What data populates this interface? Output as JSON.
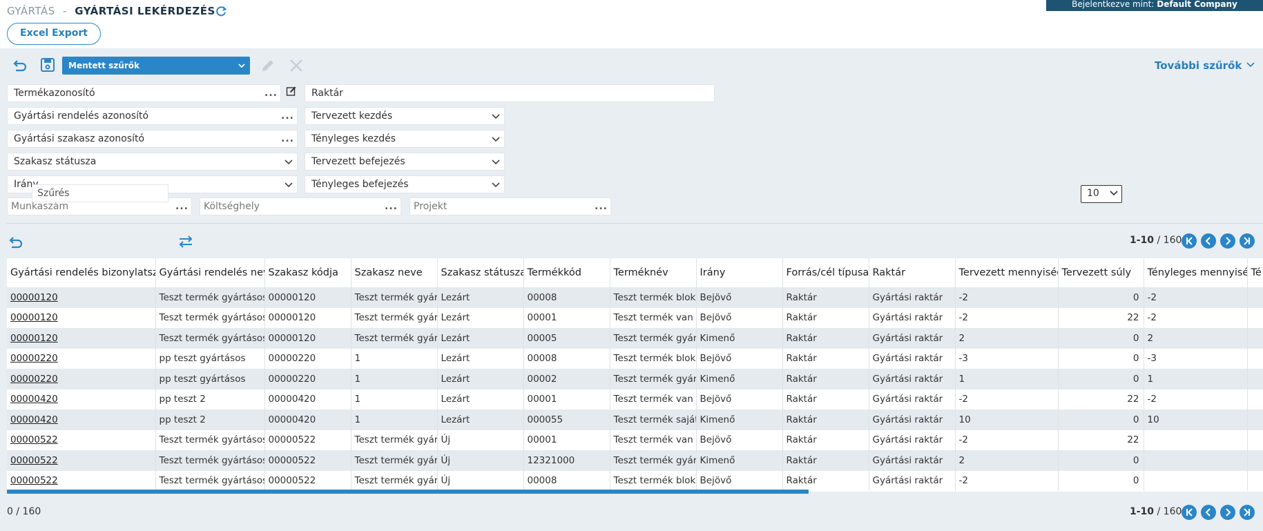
{
  "header": {
    "section": "GYÁRTÁS",
    "separator": "-",
    "title": "GYÁRTÁSI LEKÉRDEZÉS",
    "login_prefix": "Bejelentkezve mint:",
    "login_company": "Default Company",
    "excel_export": "Excel Export"
  },
  "filters": {
    "saved_filters": "Mentett szűrők",
    "more_filters": "További szűrők",
    "termekazonosito": "Termékazonosító",
    "raktar": "Raktár",
    "gyartasi_rendeles_azonosito": "Gyártási rendelés azonosító",
    "tervezett_kezdes": "Tervezett kezdés",
    "gyartasi_szakasz_azonosito": "Gyártási szakasz azonosító",
    "tenyleges_kezdes": "Tényleges kezdés",
    "szakasz_statusza": "Szakasz státusza",
    "tervezett_befejezes": "Tervezett befejezés",
    "irany": "Irány",
    "tenyleges_befejezes": "Tényleges befejezés",
    "munkaszam": "Munkaszám",
    "koltseghely": "Költséghely",
    "projekt": "Projekt",
    "dots": "..."
  },
  "grid_toolbar": {
    "search_value": "Szűrés",
    "page_size": "10",
    "range": "1-10",
    "total_sep": " / ",
    "total": "160"
  },
  "table": {
    "columns": [
      "Gyártási rendelés bizonylatszáma",
      "Gyártási rendelés neve",
      "Szakasz kódja",
      "Szakasz neve",
      "Szakasz státusza",
      "Termékkód",
      "Terméknév",
      "Irány",
      "Forrás/cél típusa",
      "Raktár",
      "Tervezett mennyiség",
      "Tervezett súly",
      "Tényleges mennyiség",
      "Té"
    ],
    "rows": [
      [
        "00000120",
        "Teszt termék gyártásos (",
        "00000120",
        "Teszt termék gyárt",
        "Lezárt",
        "00008",
        "Teszt termék blokk",
        "Bejövő",
        "Raktár",
        "Gyártási raktár",
        "-2",
        "0",
        "-2",
        ""
      ],
      [
        "00000120",
        "Teszt termék gyártásos (",
        "00000120",
        "Teszt termék gyárt",
        "Lezárt",
        "00001",
        "Teszt termék van k",
        "Bejövő",
        "Raktár",
        "Gyártási raktár",
        "-2",
        "22",
        "-2",
        ""
      ],
      [
        "00000120",
        "Teszt termék gyártásos (",
        "00000120",
        "Teszt termék gyárt",
        "Lezárt",
        "00005",
        "Teszt termék gyárt",
        "Kimenő",
        "Raktár",
        "Gyártási raktár",
        "2",
        "0",
        "2",
        ""
      ],
      [
        "00000220",
        "pp teszt gyártásos",
        "00000220",
        "1",
        "Lezárt",
        "00008",
        "Teszt termék blokk",
        "Bejövő",
        "Raktár",
        "Gyártási raktár",
        "-3",
        "0",
        "-3",
        ""
      ],
      [
        "00000220",
        "pp teszt gyártásos",
        "00000220",
        "1",
        "Lezárt",
        "00002",
        "Teszt termék gyári",
        "Kimenő",
        "Raktár",
        "Gyártási raktár",
        "1",
        "0",
        "1",
        ""
      ],
      [
        "00000420",
        "pp teszt 2",
        "00000420",
        "1",
        "Lezárt",
        "00001",
        "Teszt termék van k",
        "Bejövő",
        "Raktár",
        "Gyártási raktár",
        "-2",
        "22",
        "-2",
        ""
      ],
      [
        "00000420",
        "pp teszt 2",
        "00000420",
        "1",
        "Lezárt",
        "000055",
        "Teszt termék saját",
        "Kimenő",
        "Raktár",
        "Gyártási raktár",
        "10",
        "0",
        "10",
        ""
      ],
      [
        "00000522",
        "Teszt termék gyártásos (",
        "00000522",
        "Teszt termék gyárt",
        "Új",
        "00001",
        "Teszt termék van k",
        "Bejövő",
        "Raktár",
        "Gyártási raktár",
        "-2",
        "22",
        "",
        ""
      ],
      [
        "00000522",
        "Teszt termék gyártásos (",
        "00000522",
        "Teszt termék gyárt",
        "Új",
        "12321000",
        "Teszt termék gyárt",
        "Kimenő",
        "Raktár",
        "Gyártási raktár",
        "2",
        "0",
        "",
        ""
      ],
      [
        "00000522",
        "Teszt termék gyártásos (",
        "00000522",
        "Teszt termék gyárt",
        "Új",
        "00008",
        "Teszt termék blokk",
        "Bejövő",
        "Raktár",
        "Gyártási raktár",
        "-2",
        "0",
        "",
        ""
      ]
    ]
  },
  "footer": {
    "selected": "0",
    "sep": " /  ",
    "total": "160"
  },
  "colors": {
    "accent": "#2a86c6",
    "header_dark": "#1e5473",
    "panel_bg": "#e9eef2",
    "row_alt": "#e5eaef"
  },
  "icons": {
    "refresh": "refresh-icon",
    "undo": "undo-icon",
    "save": "save-icon",
    "edit": "pencil-icon",
    "delete": "close-icon",
    "swap": "swap-icon",
    "first": "first-page-icon",
    "prev": "prev-page-icon",
    "next": "next-page-icon",
    "last": "last-page-icon"
  }
}
